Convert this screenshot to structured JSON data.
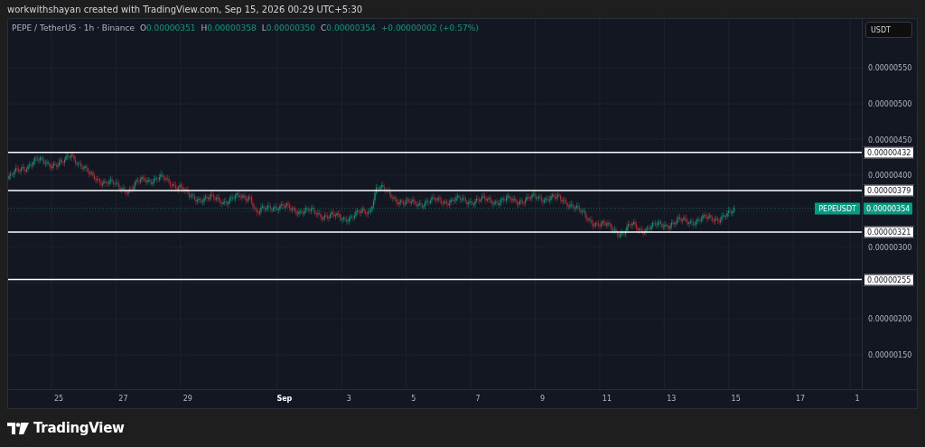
{
  "header": {
    "caption": "workwithshayan created with TradingView.com, Sep 15, 2026 00:29 UTC+5:30"
  },
  "legend": {
    "symbol": "PEPE / TetherUS · 1h · Binance",
    "values": [
      {
        "key": "O",
        "value": "0.00000351"
      },
      {
        "key": "H",
        "value": "0.00000358"
      },
      {
        "key": "L",
        "value": "0.00000350"
      },
      {
        "key": "C",
        "value": "0.00000354"
      }
    ],
    "change": "+0.00000002 (+0.57%)"
  },
  "currency_button": "USDT",
  "price_axis": [
    "0.00000550",
    "0.00000500",
    "0.00000450",
    "0.00000400",
    "0.00000300",
    "0.00000200",
    "0.00000150"
  ],
  "levels": [
    {
      "label": "0.00000432"
    },
    {
      "label": "0.00000379"
    },
    {
      "label": "0.00000321"
    },
    {
      "label": "0.00000255"
    }
  ],
  "last_price": {
    "symbol": "PEPEUSDT",
    "price": "0.00000354"
  },
  "time_axis": [
    {
      "label": "25",
      "kind": "day"
    },
    {
      "label": "27",
      "kind": "day"
    },
    {
      "label": "29",
      "kind": "day"
    },
    {
      "label": "Sep",
      "kind": "month"
    },
    {
      "label": "3",
      "kind": "day"
    },
    {
      "label": "5",
      "kind": "day"
    },
    {
      "label": "7",
      "kind": "day"
    },
    {
      "label": "9",
      "kind": "day"
    },
    {
      "label": "11",
      "kind": "day"
    },
    {
      "label": "13",
      "kind": "day"
    },
    {
      "label": "15",
      "kind": "day"
    },
    {
      "label": "17",
      "kind": "day"
    },
    {
      "label": "1",
      "kind": "day"
    }
  ],
  "footer": {
    "logo": "TradingView"
  }
}
